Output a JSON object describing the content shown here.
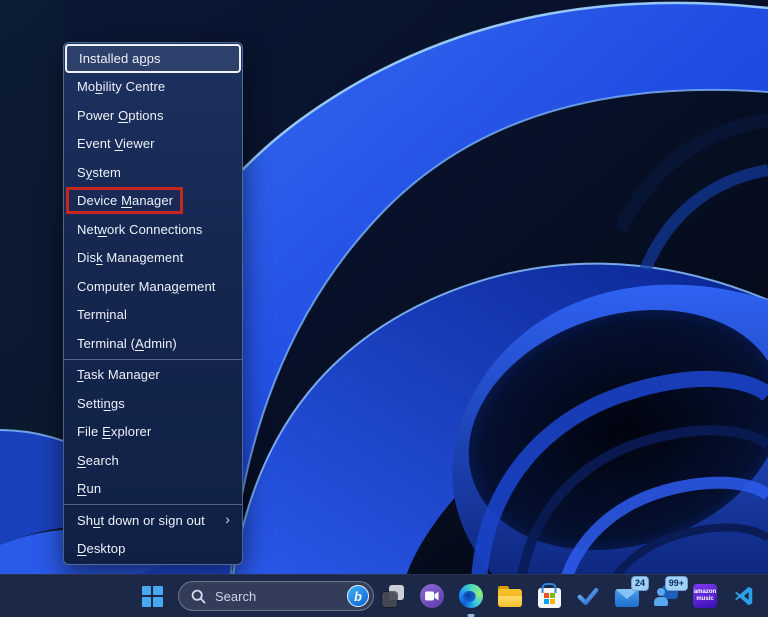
{
  "colors": {
    "red_highlight": "#c5271d",
    "taskbar_bg": "#1c2847",
    "menu_bg_top": "#1d3160",
    "accent_blue": "#2456ee",
    "focus_ring": "#edf3fc"
  },
  "winx_menu": {
    "items": [
      {
        "label": "Installed apps",
        "accel_index": 11,
        "state": "focused"
      },
      {
        "label": "Mobility Centre",
        "accel_index": 2
      },
      {
        "label": "Power Options",
        "accel_index": 6
      },
      {
        "label": "Event Viewer",
        "accel_index": 6
      },
      {
        "label": "System",
        "accel_index": 1
      },
      {
        "label": "Device Manager",
        "accel_index": 7,
        "state": "highlighted-red"
      },
      {
        "label": "Network Connections",
        "accel_index": 3
      },
      {
        "label": "Disk Management",
        "accel_index": 3
      },
      {
        "label": "Computer Management",
        "accel_index": 13
      },
      {
        "label": "Terminal",
        "accel_index": 4
      },
      {
        "label": "Terminal (Admin)",
        "accel_index": 10
      },
      {
        "separator": true
      },
      {
        "label": "Task Manager",
        "accel_index": 0
      },
      {
        "label": "Settings",
        "accel_index": 5
      },
      {
        "label": "File Explorer",
        "accel_index": 5
      },
      {
        "label": "Search",
        "accel_index": 0
      },
      {
        "label": "Run",
        "accel_index": 0
      },
      {
        "separator": true
      },
      {
        "label": "Shut down or sign out",
        "accel_index": 2,
        "submenu": true,
        "submenu_glyph": "›"
      },
      {
        "label": "Desktop",
        "accel_index": 0
      }
    ]
  },
  "taskbar": {
    "search_placeholder": "Search",
    "bing_label": "b",
    "amazon_music": {
      "line1": "amazon",
      "line2": "music"
    },
    "icons": [
      {
        "name": "start"
      },
      {
        "name": "task-view"
      },
      {
        "name": "chat"
      },
      {
        "name": "edge",
        "running": true
      },
      {
        "name": "file-explorer"
      },
      {
        "name": "microsoft-store"
      },
      {
        "name": "to-do-check"
      },
      {
        "name": "mail",
        "badge": "24"
      },
      {
        "name": "phone-link",
        "badge": "99+"
      },
      {
        "name": "amazon-music"
      },
      {
        "name": "vs-code"
      }
    ]
  }
}
